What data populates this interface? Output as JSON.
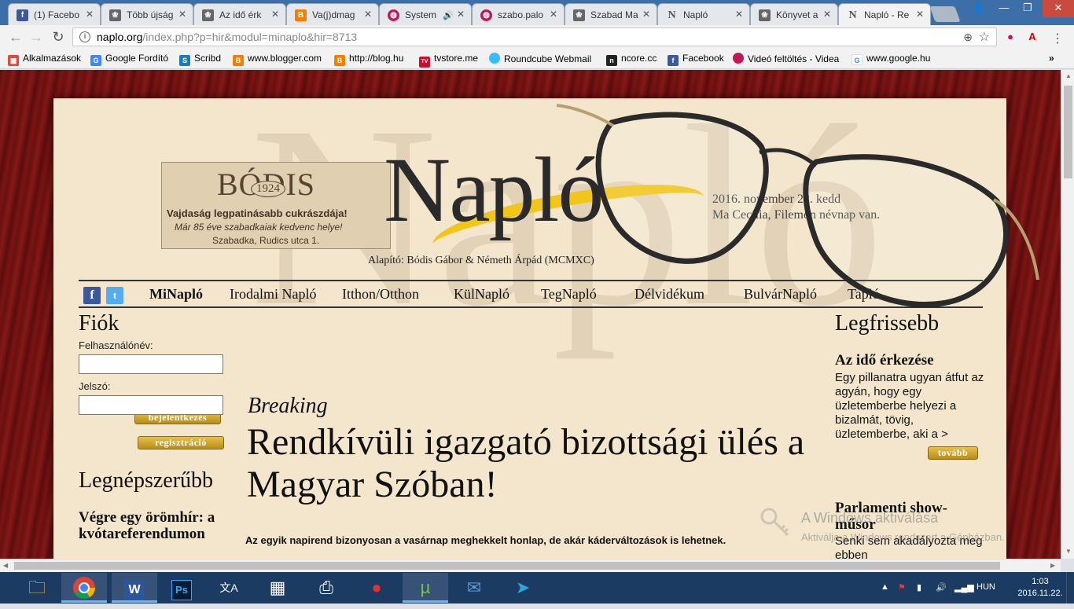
{
  "browser": {
    "tabs": [
      {
        "label": "(1) Facebo",
        "icon": "facebook-icon",
        "color": "#3b5998",
        "glyph": "f"
      },
      {
        "label": "Több újság",
        "icon": "naplo-page-icon",
        "color": "#444",
        "glyph": "❀"
      },
      {
        "label": "Az idő érk",
        "icon": "naplo-page-icon",
        "color": "#444",
        "glyph": "❀"
      },
      {
        "label": "Va(j)dmag",
        "icon": "blogger-icon",
        "color": "#f57d00",
        "glyph": "B"
      },
      {
        "label": "System",
        "icon": "videa-icon",
        "color": "#c2185b",
        "glyph": "◍"
      },
      {
        "label": "szabo.palo",
        "icon": "videa-icon",
        "color": "#c2185b",
        "glyph": "◍"
      },
      {
        "label": "Szabad Ma",
        "icon": "naplo-page-icon",
        "color": "#444",
        "glyph": "❀"
      },
      {
        "label": "Napló",
        "icon": "naplo-n-icon",
        "color": "#777",
        "glyph": "N"
      },
      {
        "label": "Könyvet a",
        "icon": "naplo-page-icon",
        "color": "#444",
        "glyph": "❀"
      },
      {
        "label": "Napló - Re",
        "icon": "naplo-n-icon",
        "color": "#777",
        "glyph": "N"
      }
    ],
    "url_host": "naplo.org",
    "url_path": "/index.php?p=hir&modul=minaplo&hir=8713",
    "bookmarks": [
      {
        "label": "Alkalmazások",
        "icon": "apps-icon",
        "color": "#e8453c",
        "glyph": "▦"
      },
      {
        "label": "Google Fordító",
        "icon": "google-translate-icon",
        "color": "#4285f4",
        "glyph": "G"
      },
      {
        "label": "Scribd",
        "icon": "scribd-icon",
        "color": "#1a7bba",
        "glyph": "S"
      },
      {
        "label": "www.blogger.com",
        "icon": "blogger-icon",
        "color": "#f57d00",
        "glyph": "B"
      },
      {
        "label": "http://blog.hu",
        "icon": "blog-hu-icon",
        "color": "#f57d00",
        "glyph": "B"
      },
      {
        "label": "tvstore.me",
        "icon": "tvstore-icon",
        "color": "#c8102e",
        "glyph": "TV"
      },
      {
        "label": "Roundcube Webmail",
        "icon": "roundcube-icon",
        "color": "#37beff",
        "glyph": "●"
      },
      {
        "label": "ncore.cc",
        "icon": "ncore-icon",
        "color": "#222",
        "glyph": "n"
      },
      {
        "label": "Facebook",
        "icon": "facebook-icon",
        "color": "#3b5998",
        "glyph": "f"
      },
      {
        "label": "Videó feltöltés - Videa",
        "icon": "videa-icon",
        "color": "#c2185b",
        "glyph": "◍"
      },
      {
        "label": "www.google.hu",
        "icon": "google-icon",
        "color": "#4285f4",
        "glyph": "G"
      }
    ]
  },
  "site": {
    "ad": {
      "brand": "BÓDIS",
      "year": "1924",
      "line1": "Vajdaság legpatinásabb cukrászdája!",
      "line2": "Már 85 éve  szabadkaiak kedvenc helye!",
      "line3": "Szabadka, Rudics utca 1."
    },
    "logo": "Napló",
    "background_word": "Napló",
    "founder": "Alapító: Bódis Gábor & Németh Árpád (MCMXC)",
    "date_line1": "2016. november 22. kedd",
    "date_line2": "Ma Cecília, Filemon névnap van.",
    "nav": [
      "MiNapló",
      "Irodalmi Napló",
      "Itthon/Otthon",
      "KülNapló",
      "TegNapló",
      "Délvidékum",
      "BulvárNapló",
      "Tapló"
    ],
    "account": {
      "title": "Fiók",
      "username_label": "Felhasználónév:",
      "password_label": "Jelszó:",
      "login_button": "bejelentkezés",
      "register_button": "regisztráció"
    },
    "popular": {
      "title": "Legnépszerűbb",
      "item1": "Végre egy örömhír: a kvótareferendumon"
    },
    "article": {
      "kicker": "Breaking",
      "headline": "Rendkívüli igazgató bizottsági ülés a Magyar Szóban!",
      "lede": "Az egyik napirend bizonyosan a vasárnap meghekkelt honlap, de akár káderváltozások is lehetnek."
    },
    "latest": {
      "title": "Legfrissebb",
      "item1_title": "Az idő érkezése",
      "item1_text": "Egy pillanatra ugyan átfut az agyán, hogy egy üzletemberbe helyezi a bizalmát, tövig, üzletemberbe, aki a >",
      "more_button": "tovább",
      "item2_title": "Parlamenti show-műsor",
      "item2_text": "Senki sem akadályozta meg ebben"
    },
    "activation_title": "A Windows aktiválása",
    "activation_text": "Aktiválja a Windows rendszert a Gépházban."
  },
  "taskbar": {
    "language": "HUN",
    "time": "1:03",
    "date": "2016.11.22."
  },
  "colors": {
    "paper": "#f3e6cd",
    "background": "#6a1010",
    "gold": "#d4a52a",
    "swoosh": "#f2c51a",
    "taskbar": "#1c3b63"
  }
}
